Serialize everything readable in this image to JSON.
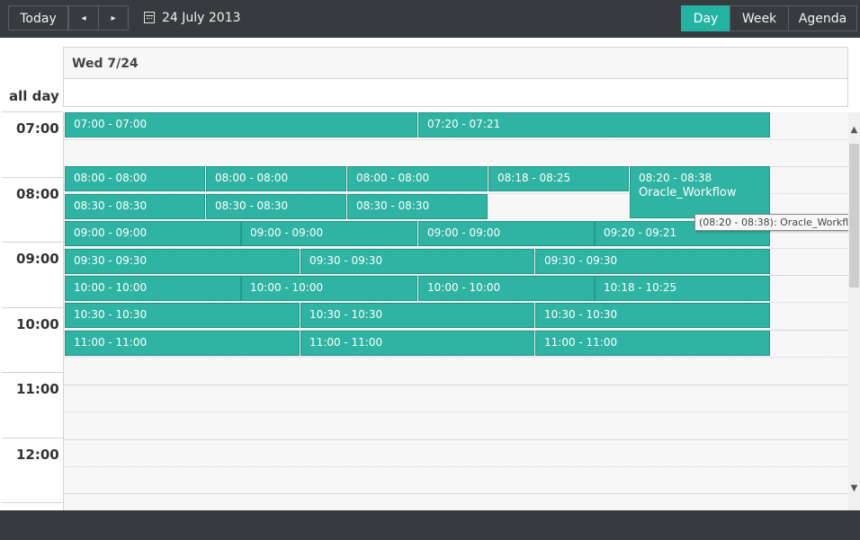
{
  "toolbar": {
    "today_label": "Today",
    "prev_icon": "◂",
    "next_icon": "▸",
    "date_label": "24 July 2013",
    "views": {
      "day": "Day",
      "week": "Week",
      "agenda": "Agenda"
    }
  },
  "header": {
    "day": "Wed 7/24",
    "all_day": "all day"
  },
  "times": [
    "07:00",
    "08:00",
    "09:00",
    "10:00",
    "11:00",
    "12:00"
  ],
  "events": {
    "e1": "07:00 - 07:00",
    "e2": "07:20 - 07:21",
    "e3": "08:00 - 08:00",
    "e4": "08:00 - 08:00",
    "e5": "08:00 - 08:00",
    "e6": "08:18 - 08:25",
    "e7": "08:20 - 08:38",
    "e7_title": "Oracle_Workflow",
    "e8": "08:30 - 08:30",
    "e9": "08:30 - 08:30",
    "e10": "08:30 - 08:30",
    "e11": "09:00 - 09:00",
    "e12": "09:00 - 09:00",
    "e13": "09:00 - 09:00",
    "e14": "09:20 - 09:21",
    "e15": "09:30 - 09:30",
    "e16": "09:30 - 09:30",
    "e17": "09:30 - 09:30",
    "e18": "10:00 - 10:00",
    "e19": "10:00 - 10:00",
    "e20": "10:00 - 10:00",
    "e21": "10:18 - 10:25",
    "e22": "10:30 - 10:30",
    "e23": "10:30 - 10:30",
    "e24": "10:30 - 10:30",
    "e25": "11:00 - 11:00",
    "e26": "11:00 - 11:00",
    "e27": "11:00 - 11:00"
  },
  "tooltip": "(08:20 - 08:38): Oracle_Workflow",
  "colors": {
    "accent": "#2fb3a3",
    "toolbar": "#373a3f"
  }
}
